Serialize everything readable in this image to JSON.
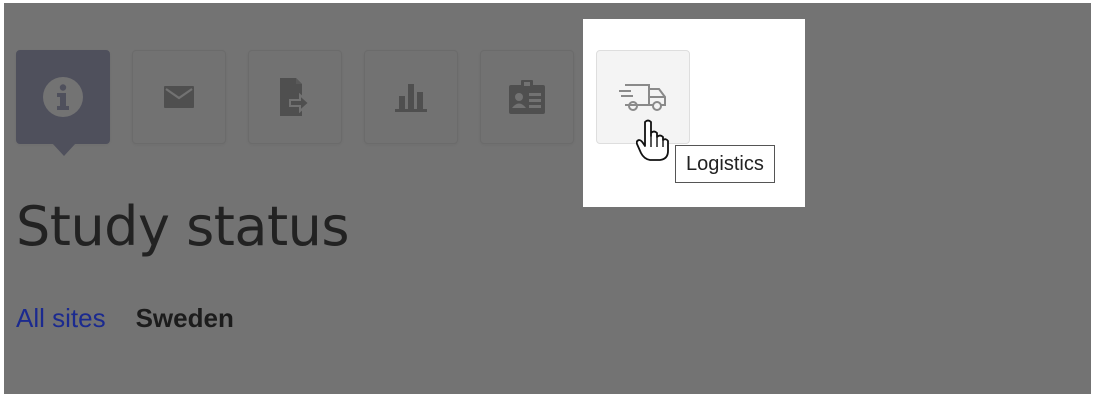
{
  "toolbar": {
    "buttons": [
      {
        "label": "Study status",
        "icon": "info-icon",
        "active": true
      },
      {
        "label": "Messages",
        "icon": "envelope-icon"
      },
      {
        "label": "Export",
        "icon": "file-export-icon"
      },
      {
        "label": "Reports",
        "icon": "bar-chart-icon"
      },
      {
        "label": "Subjects",
        "icon": "id-card-icon"
      },
      {
        "label": "Logistics",
        "icon": "truck-icon",
        "highlighted": true
      }
    ]
  },
  "tooltip": {
    "text": "Logistics"
  },
  "page": {
    "title": "Study status"
  },
  "filters": {
    "all_sites": "All sites",
    "current_site": "Sweden"
  },
  "colors": {
    "accent": "#0e1469",
    "link": "#1b2a8f",
    "overlay": "#5a5a5a"
  }
}
